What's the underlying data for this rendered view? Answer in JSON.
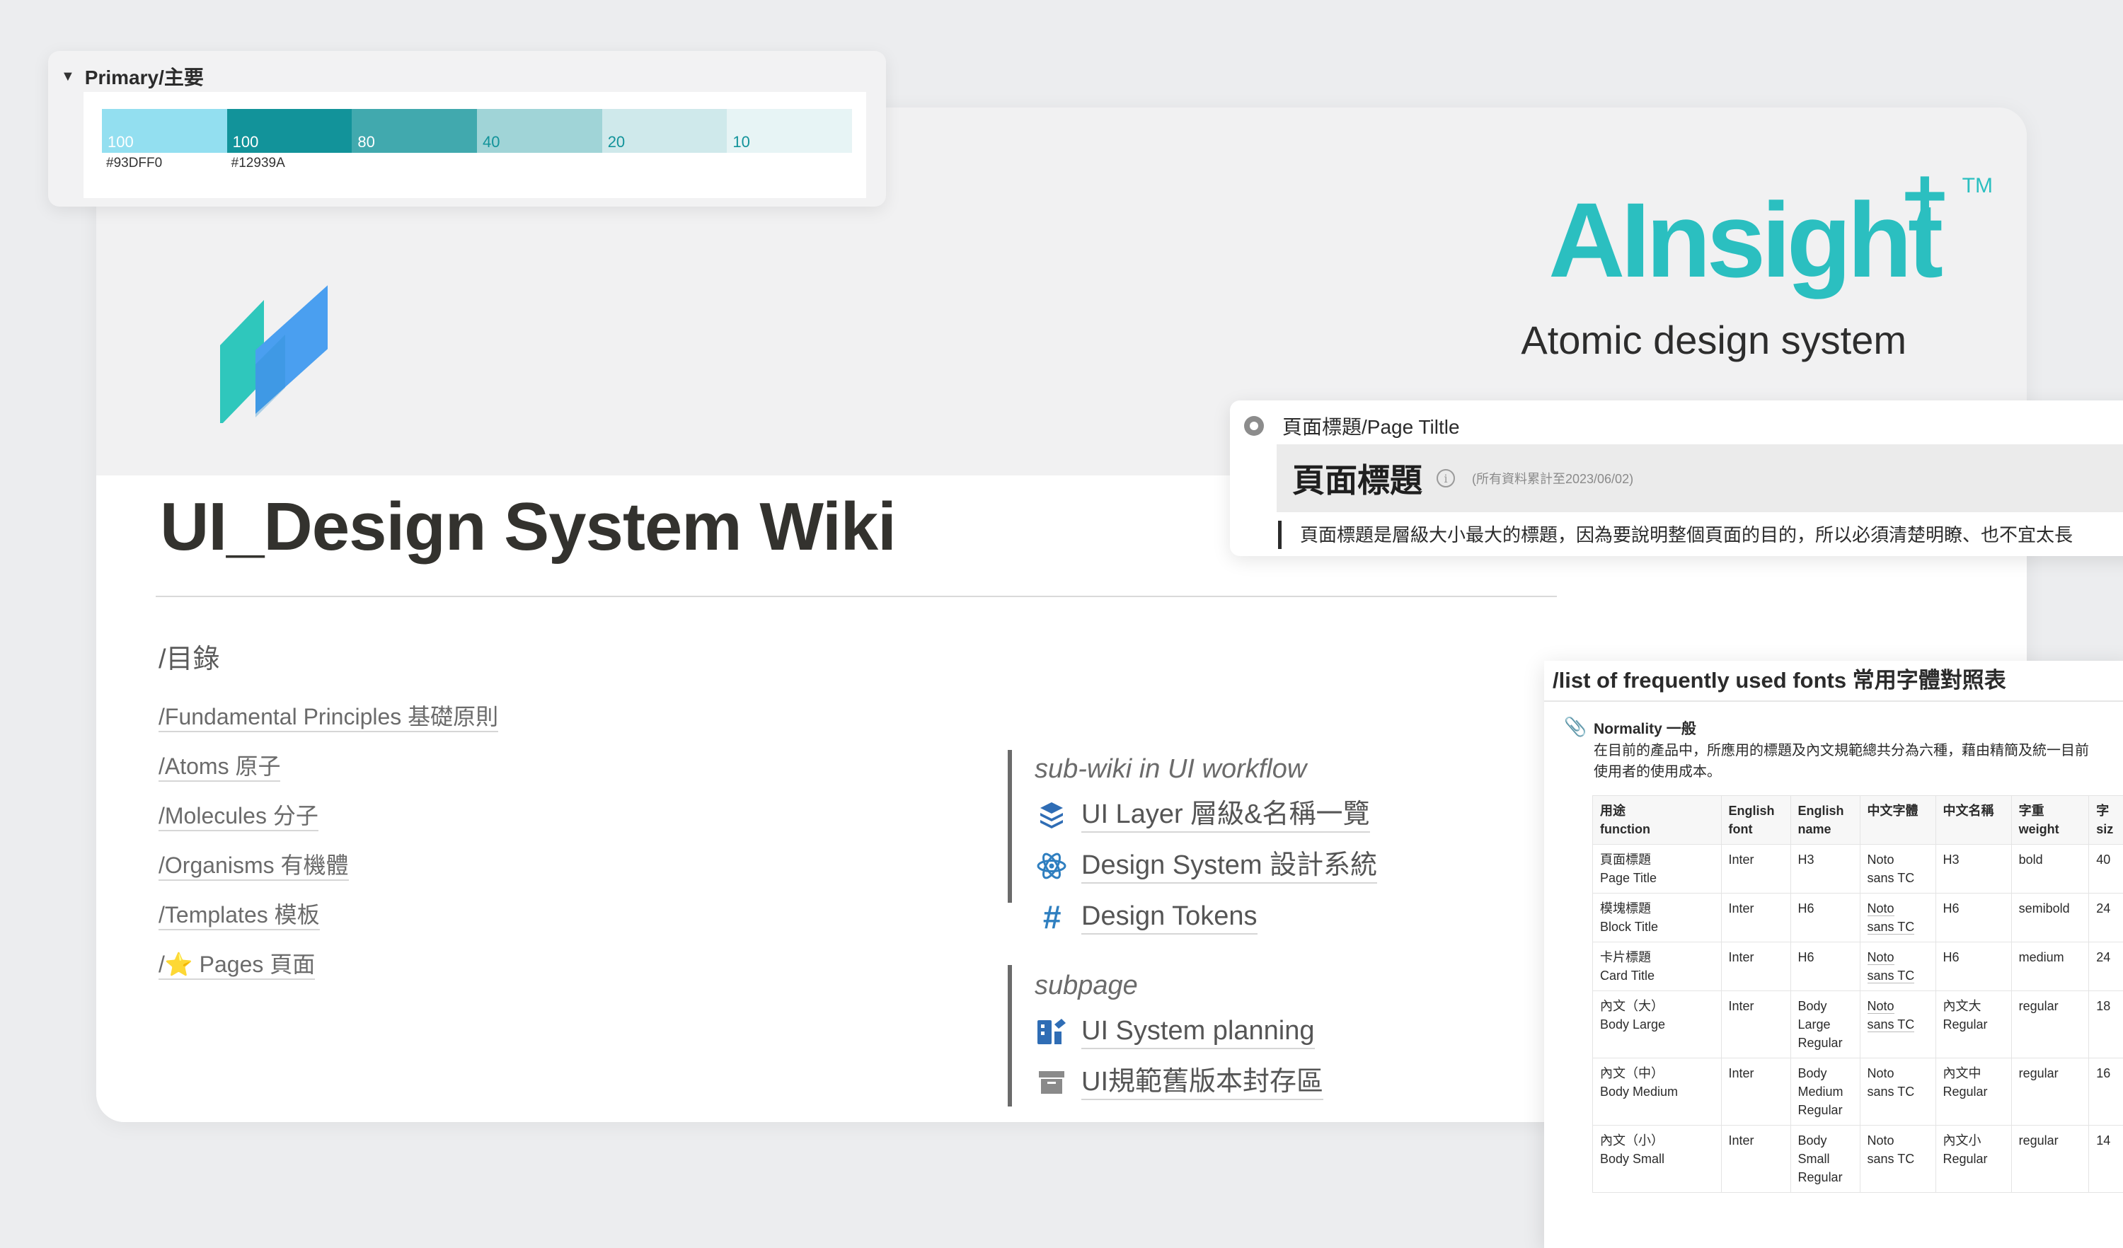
{
  "wiki": {
    "brand_name": "AInsight",
    "brand_tm": "TM",
    "brand_subtitle": "Atomic design system",
    "title": "UI_Design System Wiki",
    "toc_heading": "/目錄",
    "toc_links": [
      "/Fundamental Principles 基礎原則",
      "/Atoms 原子",
      "/Molecules 分子",
      "/Organisms 有機體",
      "/Templates 模板",
      "/⭐ Pages 頁面"
    ],
    "subwiki_heading": "sub-wiki in UI workflow",
    "subwiki_items": [
      {
        "label": "UI Layer 層級&名稱一覽",
        "icon": "layers-icon"
      },
      {
        "label": "Design System 設計系統",
        "icon": "atom-icon"
      },
      {
        "label": "Design Tokens",
        "icon": "hashtag-icon"
      }
    ],
    "subpage_heading": "subpage",
    "subpage_items": [
      {
        "label": "UI System planning",
        "icon": "planning-icon"
      },
      {
        "label": "UI規範舊版本封存區",
        "icon": "archive-icon"
      }
    ]
  },
  "palette": {
    "title": "Primary/主要",
    "swatches": [
      {
        "label": "100",
        "hex": "#93DFF0",
        "color": "#93dff0",
        "text_color": "#ffffff"
      },
      {
        "label": "100",
        "hex": "#12939A",
        "color": "#12939a",
        "text_color": "#ffffff"
      },
      {
        "label": "80",
        "hex": "",
        "color": "#41a9ae",
        "text_color": "#ffffff"
      },
      {
        "label": "40",
        "hex": "",
        "color": "#a0d4d7",
        "text_color": "#12939a"
      },
      {
        "label": "20",
        "hex": "",
        "color": "#cfe9eb",
        "text_color": "#12939a"
      },
      {
        "label": "10",
        "hex": "",
        "color": "#e7f4f5",
        "text_color": "#12939a"
      }
    ]
  },
  "page_title_panel": {
    "header": "頁面標題/Page Tiltle",
    "big_title": "頁面標題",
    "note": "(所有資料累計至2023/06/02)",
    "quote": "頁面標題是層級大小最大的標題，因為要說明整個頁面的目的，所以必須清楚明瞭、也不宜太長"
  },
  "fonts_panel": {
    "title": "/list of frequently used fonts 常用字體對照表",
    "section_title": "Normality 一般",
    "section_desc_1": "在目前的產品中，所應用的標題及內文規範總共分為六種，藉由精簡及統一目前",
    "section_desc_2": "使用者的使用成本。",
    "headers": [
      [
        "用途",
        "function"
      ],
      [
        "English",
        "font"
      ],
      [
        "English",
        "name"
      ],
      [
        "中文字體",
        ""
      ],
      [
        "中文名稱",
        ""
      ],
      [
        "字重",
        "weight"
      ],
      [
        "字",
        "siz"
      ]
    ],
    "rows": [
      {
        "function_zh": "頁面標題",
        "function_en": "Page Title",
        "en_font": "Inter",
        "en_name": [
          "H3"
        ],
        "zh_font": [
          "Noto",
          "sans TC"
        ],
        "zh_name": [
          "H3"
        ],
        "weight": "bold",
        "size": "40"
      },
      {
        "function_zh": "模塊標題",
        "function_en": "Block Title",
        "en_font": "Inter",
        "en_name": [
          "H6"
        ],
        "zh_font": [
          "Noto",
          "sans TC"
        ],
        "zh_name": [
          "H6"
        ],
        "weight": "semibold",
        "size": "24"
      },
      {
        "function_zh": "卡片標題",
        "function_en": "Card Title",
        "en_font": "Inter",
        "en_name": [
          "H6"
        ],
        "zh_font": [
          "Noto",
          "sans TC"
        ],
        "zh_name": [
          "H6"
        ],
        "weight": "medium",
        "size": "24"
      },
      {
        "function_zh": "內文（大）",
        "function_en": "Body Large",
        "en_font": "Inter",
        "en_name": [
          "Body",
          "Large",
          "Regular"
        ],
        "zh_font": [
          "Noto",
          "sans TC"
        ],
        "zh_name": [
          "內文大",
          "Regular"
        ],
        "weight": "regular",
        "size": "18"
      },
      {
        "function_zh": "內文（中）",
        "function_en": "Body Medium",
        "en_font": "Inter",
        "en_name": [
          "Body",
          "Medium",
          "Regular"
        ],
        "zh_font": [
          "Noto",
          "sans TC"
        ],
        "zh_name": [
          "內文中",
          "Regular"
        ],
        "weight": "regular",
        "size": "16"
      },
      {
        "function_zh": "內文（小）",
        "function_en": "Body Small",
        "en_font": "Inter",
        "en_name": [
          "Body",
          "Small",
          "Regular"
        ],
        "zh_font": [
          "Noto",
          "sans TC"
        ],
        "zh_name": [
          "內文小",
          "Regular"
        ],
        "weight": "regular",
        "size": "14"
      }
    ]
  }
}
